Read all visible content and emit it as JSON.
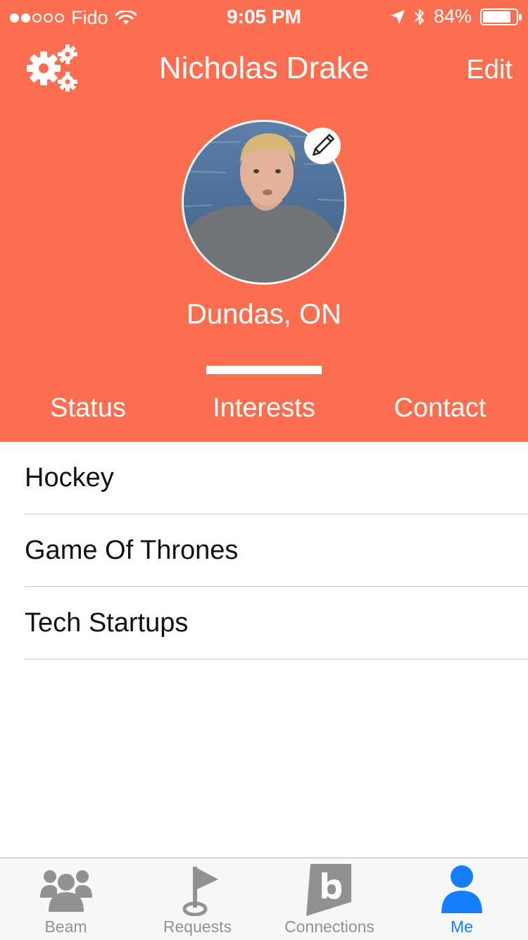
{
  "status_bar": {
    "carrier": "Fido",
    "time": "9:05 PM",
    "battery": "84%",
    "battery_level": 0.84
  },
  "nav": {
    "title": "Nicholas Drake",
    "edit_label": "Edit",
    "settings_icon": "gears-icon"
  },
  "profile": {
    "location": "Dundas, ON",
    "edit_photo_icon": "pencil-icon"
  },
  "tabs": [
    {
      "label": "Status",
      "active": false
    },
    {
      "label": "Interests",
      "active": true
    },
    {
      "label": "Contact",
      "active": false
    }
  ],
  "interests": [
    {
      "label": "Hockey"
    },
    {
      "label": "Game Of Thrones"
    },
    {
      "label": "Tech Startups"
    }
  ],
  "tab_bar": [
    {
      "label": "Beam",
      "icon": "group-icon",
      "active": false
    },
    {
      "label": "Requests",
      "icon": "flag-icon",
      "active": false
    },
    {
      "label": "Connections",
      "icon": "b-logo-icon",
      "active": false
    },
    {
      "label": "Me",
      "icon": "person-icon",
      "active": true
    }
  ],
  "colors": {
    "header_bg": "#fb6e4f",
    "active_tab": "#157efb",
    "inactive_tab": "#929292"
  }
}
